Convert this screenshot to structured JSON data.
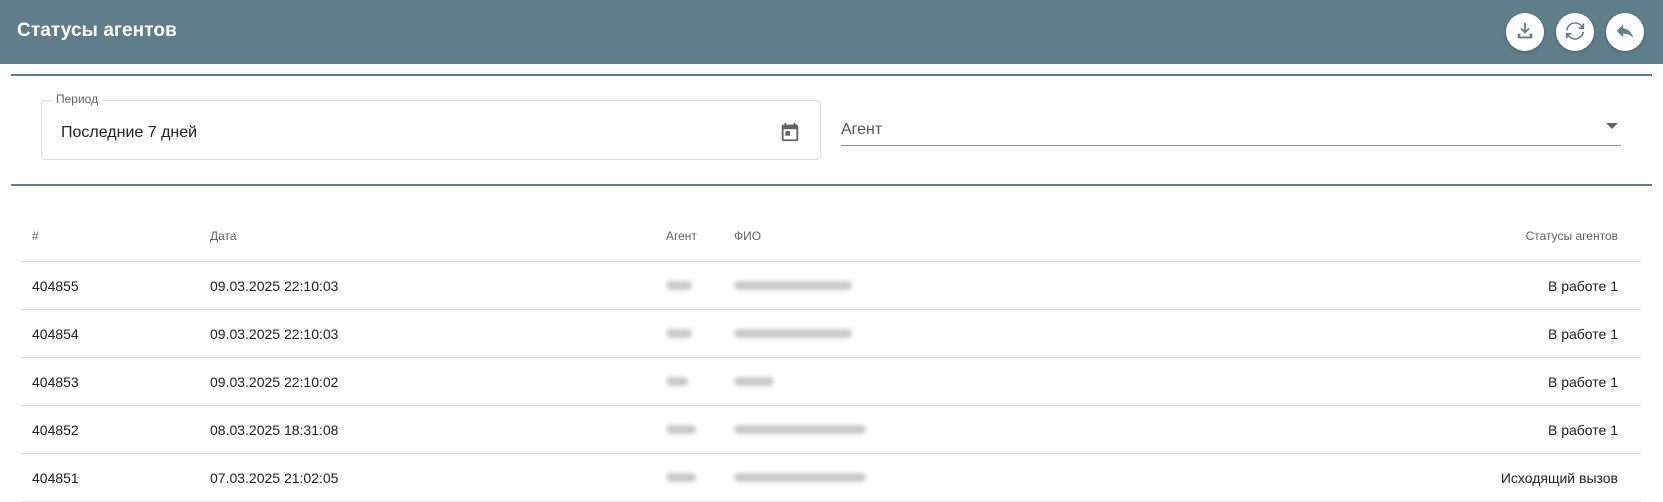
{
  "header": {
    "title": "Статусы агентов",
    "buttons": [
      "download-icon",
      "refresh-icon",
      "back-arrow-icon"
    ],
    "bg_color": "#607d8b"
  },
  "filters": {
    "period_label": "Период",
    "period_value": "Последние 7 дней",
    "agent_label": "Агент"
  },
  "table": {
    "columns": [
      "#",
      "Дата",
      "Агент",
      "ФИО",
      "Статусы агентов"
    ],
    "rows": [
      {
        "id": "404855",
        "date": "09.03.2025 22:10:03",
        "agent": "",
        "fio": "",
        "status": "В работе 1"
      },
      {
        "id": "404854",
        "date": "09.03.2025 22:10:03",
        "agent": "",
        "fio": "",
        "status": "В работе 1"
      },
      {
        "id": "404853",
        "date": "09.03.2025 22:10:02",
        "agent": "",
        "fio": "",
        "status": "В работе 1"
      },
      {
        "id": "404852",
        "date": "08.03.2025 18:31:08",
        "agent": "",
        "fio": "",
        "status": "В работе 1"
      },
      {
        "id": "404851",
        "date": "07.03.2025 21:02:05",
        "agent": "",
        "fio": "",
        "status": "Исходящий вызов"
      }
    ]
  }
}
